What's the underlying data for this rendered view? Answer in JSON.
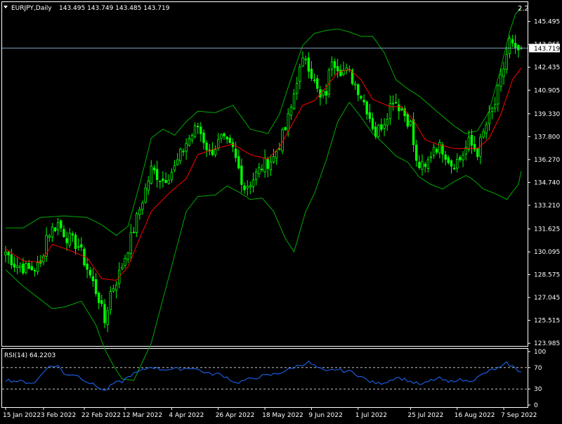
{
  "window": {
    "symbol_label": "EURJPY,Daily",
    "ohlc": "143.495 143.749 143.485 143.719",
    "corner_value": "2.2",
    "current_price_label": "143.719"
  },
  "colors": {
    "background": "#000000",
    "frame": "#ffffff",
    "candle": "#00ff00",
    "bands": "#00aa00",
    "ma": "#ff0000",
    "rsi": "#1e6bff",
    "price_line": "#7f9fbf",
    "levels": "#c0c0c0"
  },
  "chart_data": [
    {
      "type": "candlestick",
      "title": "EURJPY,Daily",
      "y_ticks": [
        "145.495",
        "143.965",
        "142.435",
        "140.905",
        "139.330",
        "137.800",
        "136.270",
        "134.740",
        "133.210",
        "131.625",
        "130.095",
        "128.575",
        "127.045",
        "125.515",
        "123.985"
      ],
      "y_tick_values": [
        145.495,
        143.965,
        142.435,
        140.905,
        139.33,
        137.8,
        136.27,
        134.74,
        133.21,
        131.625,
        130.095,
        128.575,
        127.045,
        125.515,
        123.985
      ],
      "ylim": [
        123.9,
        146.7
      ],
      "last_price": 143.719,
      "x_ticks": [
        "15 Jan 2022",
        "3 Feb 2022",
        "22 Feb 2022",
        "12 Mar 2022",
        "4 Apr 2022",
        "26 Apr 2022",
        "18 May 2022",
        "9 Jun 2022",
        "1 Jul 2022",
        "25 Jul 2022",
        "16 Aug 2022",
        "7 Sep 2022"
      ],
      "x_tick_index": [
        0,
        13,
        27,
        41,
        57,
        73,
        89,
        105,
        121,
        139,
        155,
        171
      ],
      "candle_count": 178,
      "close_anchors": [
        [
          0,
          130.1
        ],
        [
          3,
          129.3
        ],
        [
          8,
          128.9
        ],
        [
          12,
          129.2
        ],
        [
          14,
          131.2
        ],
        [
          18,
          132.0
        ],
        [
          21,
          131.1
        ],
        [
          25,
          130.5
        ],
        [
          28,
          129.0
        ],
        [
          32,
          127.0
        ],
        [
          34,
          125.4
        ],
        [
          36,
          127.4
        ],
        [
          39,
          128.6
        ],
        [
          43,
          131.0
        ],
        [
          47,
          133.6
        ],
        [
          50,
          135.6
        ],
        [
          54,
          134.9
        ],
        [
          58,
          135.7
        ],
        [
          62,
          137.4
        ],
        [
          66,
          138.5
        ],
        [
          70,
          136.7
        ],
        [
          74,
          137.6
        ],
        [
          78,
          136.9
        ],
        [
          82,
          134.4
        ],
        [
          85,
          135.0
        ],
        [
          88,
          135.8
        ],
        [
          92,
          136.4
        ],
        [
          96,
          138.3
        ],
        [
          98,
          139.7
        ],
        [
          100,
          141.7
        ],
        [
          103,
          143.2
        ],
        [
          106,
          141.4
        ],
        [
          108,
          140.3
        ],
        [
          110,
          140.8
        ],
        [
          112,
          143.1
        ],
        [
          115,
          142.3
        ],
        [
          118,
          142.0
        ],
        [
          121,
          141.0
        ],
        [
          124,
          139.7
        ],
        [
          127,
          138.0
        ],
        [
          130,
          138.9
        ],
        [
          133,
          140.4
        ],
        [
          136,
          139.6
        ],
        [
          139,
          138.6
        ],
        [
          141,
          136.0
        ],
        [
          144,
          135.6
        ],
        [
          147,
          137.2
        ],
        [
          150,
          137.0
        ],
        [
          153,
          136.0
        ],
        [
          156,
          136.3
        ],
        [
          159,
          137.4
        ],
        [
          162,
          136.8
        ],
        [
          165,
          138.6
        ],
        [
          168,
          140.0
        ],
        [
          171,
          142.4
        ],
        [
          173,
          144.2
        ],
        [
          175,
          143.4
        ],
        [
          177,
          143.7
        ]
      ],
      "ma_anchors": [
        [
          0,
          130.3
        ],
        [
          6,
          129.5
        ],
        [
          12,
          129.4
        ],
        [
          16,
          130.6
        ],
        [
          22,
          130.2
        ],
        [
          28,
          129.7
        ],
        [
          33,
          128.3
        ],
        [
          38,
          128.2
        ],
        [
          42,
          129.1
        ],
        [
          46,
          131.0
        ],
        [
          50,
          132.8
        ],
        [
          56,
          134.0
        ],
        [
          62,
          135.0
        ],
        [
          66,
          136.6
        ],
        [
          72,
          137.0
        ],
        [
          78,
          137.3
        ],
        [
          84,
          136.6
        ],
        [
          90,
          136.3
        ],
        [
          94,
          137.1
        ],
        [
          98,
          138.5
        ],
        [
          102,
          139.9
        ],
        [
          106,
          140.2
        ],
        [
          110,
          141.1
        ],
        [
          114,
          142.1
        ],
        [
          118,
          142.3
        ],
        [
          122,
          141.6
        ],
        [
          126,
          140.3
        ],
        [
          132,
          139.8
        ],
        [
          136,
          139.8
        ],
        [
          140,
          138.9
        ],
        [
          144,
          137.6
        ],
        [
          148,
          137.3
        ],
        [
          154,
          137.0
        ],
        [
          158,
          137.0
        ],
        [
          162,
          137.0
        ],
        [
          166,
          137.7
        ],
        [
          170,
          139.3
        ],
        [
          174,
          141.6
        ],
        [
          177,
          142.4
        ]
      ],
      "upper_band_anchors": [
        [
          0,
          131.7
        ],
        [
          6,
          131.7
        ],
        [
          12,
          132.4
        ],
        [
          20,
          132.5
        ],
        [
          28,
          132.4
        ],
        [
          33,
          131.9
        ],
        [
          38,
          131.2
        ],
        [
          42,
          131.8
        ],
        [
          46,
          134.6
        ],
        [
          50,
          137.7
        ],
        [
          54,
          138.3
        ],
        [
          58,
          137.9
        ],
        [
          62,
          138.8
        ],
        [
          66,
          139.5
        ],
        [
          72,
          139.4
        ],
        [
          78,
          139.9
        ],
        [
          84,
          138.3
        ],
        [
          90,
          138.0
        ],
        [
          94,
          139.3
        ],
        [
          98,
          141.7
        ],
        [
          102,
          143.9
        ],
        [
          106,
          144.7
        ],
        [
          110,
          144.9
        ],
        [
          114,
          145.0
        ],
        [
          118,
          144.8
        ],
        [
          122,
          144.5
        ],
        [
          126,
          144.5
        ],
        [
          130,
          143.4
        ],
        [
          134,
          141.6
        ],
        [
          138,
          141.0
        ],
        [
          142,
          140.5
        ],
        [
          148,
          139.5
        ],
        [
          154,
          138.5
        ],
        [
          158,
          138.0
        ],
        [
          162,
          138.2
        ],
        [
          166,
          139.5
        ],
        [
          170,
          142.4
        ],
        [
          173,
          144.8
        ],
        [
          175,
          146.0
        ],
        [
          177,
          146.4
        ]
      ],
      "lower_band_anchors": [
        [
          0,
          128.9
        ],
        [
          6,
          127.8
        ],
        [
          12,
          126.9
        ],
        [
          16,
          126.3
        ],
        [
          20,
          126.4
        ],
        [
          26,
          126.8
        ],
        [
          31,
          125.2
        ],
        [
          34,
          123.6
        ],
        [
          37,
          122.5
        ],
        [
          40,
          121.6
        ],
        [
          44,
          121.5
        ],
        [
          50,
          124.0
        ],
        [
          56,
          128.4
        ],
        [
          62,
          132.8
        ],
        [
          66,
          133.8
        ],
        [
          72,
          133.9
        ],
        [
          76,
          134.5
        ],
        [
          80,
          134.1
        ],
        [
          84,
          133.6
        ],
        [
          88,
          133.7
        ],
        [
          92,
          132.8
        ],
        [
          96,
          131.0
        ],
        [
          99,
          130.1
        ],
        [
          103,
          132.8
        ],
        [
          106,
          134.0
        ],
        [
          110,
          136.2
        ],
        [
          114,
          138.8
        ],
        [
          118,
          140.1
        ],
        [
          122,
          139.1
        ],
        [
          126,
          138.0
        ],
        [
          130,
          137.3
        ],
        [
          134,
          136.5
        ],
        [
          138,
          136.1
        ],
        [
          142,
          135.1
        ],
        [
          146,
          134.6
        ],
        [
          150,
          134.3
        ],
        [
          154,
          134.8
        ],
        [
          158,
          135.2
        ],
        [
          160,
          135.0
        ],
        [
          164,
          134.3
        ],
        [
          168,
          134.0
        ],
        [
          172,
          133.6
        ],
        [
          176,
          134.6
        ],
        [
          177,
          135.5
        ]
      ],
      "series": [
        {
          "name": "EURJPY,Daily",
          "type": "candlestick"
        }
      ]
    },
    {
      "type": "line",
      "title": "RSI(14) 64.2203",
      "y_ticks": [
        "100",
        "70",
        "30",
        "0"
      ],
      "y_tick_values": [
        100,
        70,
        30,
        0
      ],
      "levels": [
        70,
        30
      ],
      "ylim": [
        0,
        100
      ],
      "anchors": [
        [
          0,
          47
        ],
        [
          5,
          44
        ],
        [
          10,
          41
        ],
        [
          14,
          70
        ],
        [
          18,
          74
        ],
        [
          20,
          58
        ],
        [
          24,
          57
        ],
        [
          28,
          44
        ],
        [
          32,
          33
        ],
        [
          34,
          26
        ],
        [
          37,
          40
        ],
        [
          40,
          44
        ],
        [
          43,
          56
        ],
        [
          47,
          65
        ],
        [
          50,
          72
        ],
        [
          53,
          67
        ],
        [
          57,
          67
        ],
        [
          61,
          68
        ],
        [
          64,
          70
        ],
        [
          67,
          64
        ],
        [
          70,
          58
        ],
        [
          73,
          58
        ],
        [
          76,
          52
        ],
        [
          79,
          41
        ],
        [
          82,
          46
        ],
        [
          85,
          50
        ],
        [
          88,
          54
        ],
        [
          91,
          56
        ],
        [
          94,
          60
        ],
        [
          97,
          66
        ],
        [
          100,
          73
        ],
        [
          104,
          80
        ],
        [
          107,
          70
        ],
        [
          110,
          62
        ],
        [
          113,
          67
        ],
        [
          116,
          64
        ],
        [
          119,
          62
        ],
        [
          122,
          53
        ],
        [
          125,
          44
        ],
        [
          128,
          40
        ],
        [
          131,
          44
        ],
        [
          134,
          52
        ],
        [
          137,
          48
        ],
        [
          140,
          42
        ],
        [
          143,
          38
        ],
        [
          146,
          46
        ],
        [
          149,
          50
        ],
        [
          152,
          42
        ],
        [
          155,
          48
        ],
        [
          158,
          45
        ],
        [
          161,
          48
        ],
        [
          164,
          58
        ],
        [
          167,
          66
        ],
        [
          170,
          70
        ],
        [
          172,
          78
        ],
        [
          174,
          72
        ],
        [
          176,
          64
        ],
        [
          177,
          64.2
        ]
      ]
    }
  ]
}
